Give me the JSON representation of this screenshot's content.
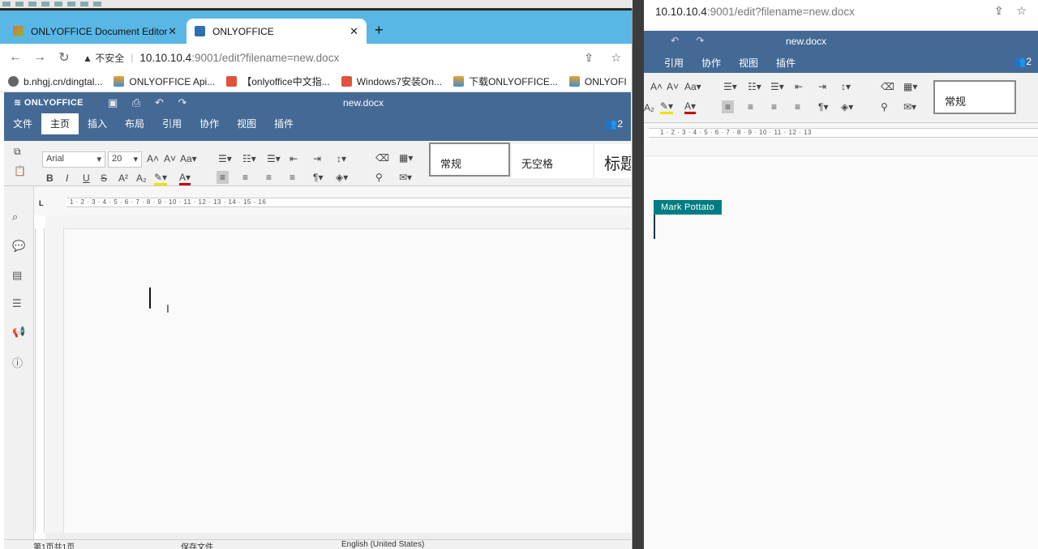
{
  "left_browser": {
    "tabs": [
      {
        "label": "ONLYOFFICE Document Editor",
        "icon": "onlyoffice-layers-icon",
        "color": "#e46f2e"
      },
      {
        "label": "ONLYOFFICE",
        "icon": "document-icon",
        "color": "#2f6fb0",
        "active": true
      }
    ],
    "url_warning": "不安全",
    "url_host": "10.10.10.4",
    "url_path": ":9001/edit?filename=new.docx",
    "bookmarks": [
      {
        "label": "b.nhgj.cn/dingtal...",
        "icon": "globe-icon",
        "color": "#555"
      },
      {
        "label": "ONLYOFFICE Api...",
        "icon": "onlyoffice-layers-icon",
        "color": "#f0a020"
      },
      {
        "label": "【onlyoffice中文指...",
        "icon": "jian-icon",
        "color": "#e0533c"
      },
      {
        "label": "Windows7安装On...",
        "icon": "jian-icon",
        "color": "#e0533c"
      },
      {
        "label": "下载ONLYOFFICE...",
        "icon": "onlyoffice-layers-icon",
        "color": "#f0a020"
      },
      {
        "label": "ONLYOFI",
        "icon": "onlyoffice-layers-icon",
        "color": "#f0a020"
      }
    ]
  },
  "editor": {
    "brand": "ONLYOFFICE",
    "doc_title": "new.docx",
    "menu": [
      "文件",
      "主页",
      "插入",
      "布局",
      "引用",
      "协作",
      "视图",
      "插件"
    ],
    "active_menu": "主页",
    "user_count": "2",
    "font_name": "Arial",
    "font_size": "20",
    "styles": [
      "常规",
      "无空格",
      "标题"
    ],
    "ruler_numbers": "1 · 2 · 3 · 4 · 5 · 6 · 7 · 8 · 9 · 10 · 11 · 12 · 13 · 14 · 15 · 16",
    "status_page": "第1页共1页",
    "status_saving": "保存文件",
    "status_language": "English (United States)"
  },
  "right_browser": {
    "url_host": "10.10.10.4",
    "url_path": ":9001/edit?filename=new.docx",
    "doc_title": "new.docx",
    "menu": [
      "引用",
      "协作",
      "视图",
      "插件"
    ],
    "user_count": "2",
    "style_active": "常规",
    "ruler_numbers": "1 · 2 · 3 · 4 · 5 · 6 · 7 · 8 · 9 · 10 · 11 · 12 · 13",
    "collaborator_name": "Mark Pottato",
    "collaborator_color": "#007d83"
  }
}
